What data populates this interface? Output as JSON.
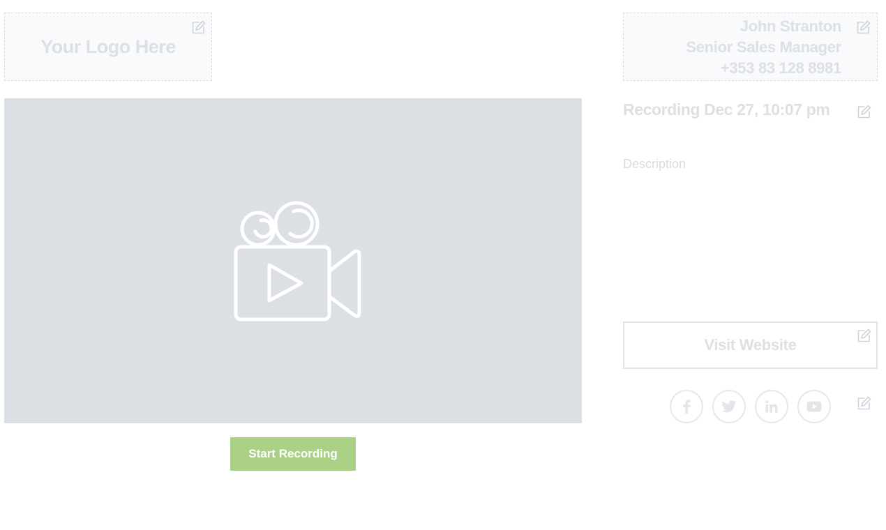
{
  "logo": {
    "text": "Your Logo Here"
  },
  "contact": {
    "name": "John Stranton",
    "title": "Senior Sales Manager",
    "phone": "+353 83 128 8981"
  },
  "video": {
    "placeholder_icon": "video-camera-play-icon"
  },
  "actions": {
    "start_recording": "Start Recording"
  },
  "recording": {
    "title": "Recording Dec 27, 10:07 pm",
    "description_placeholder": "Description"
  },
  "website": {
    "label": "Visit Website"
  },
  "social": {
    "items": [
      "facebook-icon",
      "twitter-icon",
      "linkedin-icon",
      "youtube-icon"
    ]
  },
  "colors": {
    "accent": "#aad086",
    "video_bg": "#dcdfe3",
    "placeholder_text": "#dcdfe4",
    "box_bg": "#f9fafb"
  },
  "icons": {
    "edit": "edit-pencil-icon"
  }
}
